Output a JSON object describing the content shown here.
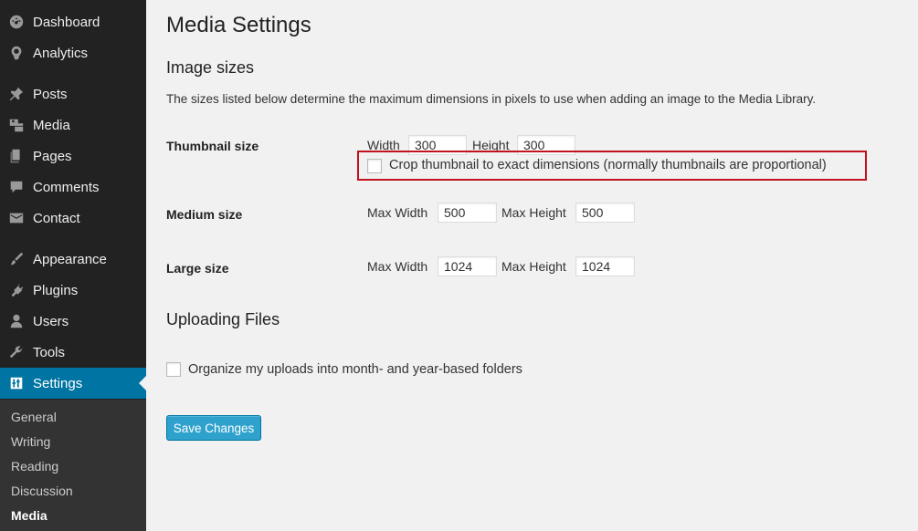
{
  "sidebar": {
    "items": [
      {
        "label": "Dashboard",
        "icon": "dashboard-icon"
      },
      {
        "label": "Analytics",
        "icon": "analytics-icon"
      },
      {
        "label": "Posts",
        "icon": "pushpin-icon"
      },
      {
        "label": "Media",
        "icon": "media-icon"
      },
      {
        "label": "Pages",
        "icon": "pages-icon"
      },
      {
        "label": "Comments",
        "icon": "comment-icon"
      },
      {
        "label": "Contact",
        "icon": "envelope-icon"
      },
      {
        "label": "Appearance",
        "icon": "paintbrush-icon"
      },
      {
        "label": "Plugins",
        "icon": "plug-icon"
      },
      {
        "label": "Users",
        "icon": "user-icon"
      },
      {
        "label": "Tools",
        "icon": "wrench-icon"
      },
      {
        "label": "Settings",
        "icon": "settings-icon"
      }
    ],
    "submenu": [
      "General",
      "Writing",
      "Reading",
      "Discussion",
      "Media"
    ],
    "active_color": "#0074a2"
  },
  "page": {
    "title": "Media Settings",
    "image_sizes_heading": "Image sizes",
    "description": "The sizes listed below determine the maximum dimensions in pixels to use when adding an image to the Media Library.",
    "thumbnail": {
      "label": "Thumbnail size",
      "width_label": "Width",
      "width_value": "300",
      "height_label": "Height",
      "height_value": "300",
      "crop_label": "Crop thumbnail to exact dimensions (normally thumbnails are proportional)",
      "crop_checked": false
    },
    "medium": {
      "label": "Medium size",
      "width_label": "Max Width",
      "width_value": "500",
      "height_label": "Max Height",
      "height_value": "500"
    },
    "large": {
      "label": "Large size",
      "width_label": "Max Width",
      "width_value": "1024",
      "height_label": "Max Height",
      "height_value": "1024"
    },
    "uploading_heading": "Uploading Files",
    "organize_label": "Organize my uploads into month- and year-based folders",
    "organize_checked": false,
    "save_label": "Save Changes",
    "highlight_color": "#c1121f"
  }
}
